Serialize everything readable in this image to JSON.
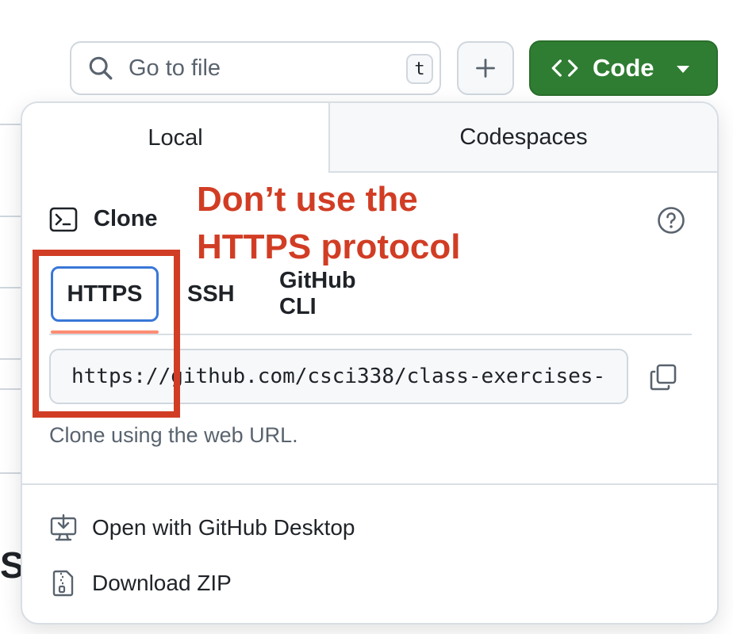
{
  "toolbar": {
    "search_placeholder": "Go to file",
    "search_shortcut": "t",
    "add_icon": "plus-icon",
    "code_label": "Code",
    "code_icon": "code-brackets-icon"
  },
  "panel": {
    "tabs": [
      {
        "label": "Local",
        "active": true
      },
      {
        "label": "Codespaces",
        "active": false
      }
    ],
    "clone": {
      "title": "Clone",
      "icon": "terminal-icon",
      "help_icon": "question-circle-icon",
      "subtabs": [
        {
          "label": "HTTPS",
          "active": true
        },
        {
          "label": "SSH",
          "active": false
        },
        {
          "label": "GitHub CLI",
          "active": false
        }
      ],
      "url_value": "https://github.com/csci338/class-exercises-",
      "copy_icon": "copy-icon",
      "hint": "Clone using the web URL."
    },
    "actions": [
      {
        "label": "Open with GitHub Desktop",
        "icon": "desktop-download-icon"
      },
      {
        "label": "Download ZIP",
        "icon": "file-zip-icon"
      }
    ]
  },
  "annotation": {
    "text": "Don’t use the HTTPS protocol",
    "color": "#d13d24"
  },
  "background": {
    "partial_heading_char": "S"
  },
  "colors": {
    "code_button": "#2f7d32",
    "active_underline": "#fd8c73",
    "focus_ring": "#3a77d8",
    "annotation_red": "#d13d24"
  }
}
